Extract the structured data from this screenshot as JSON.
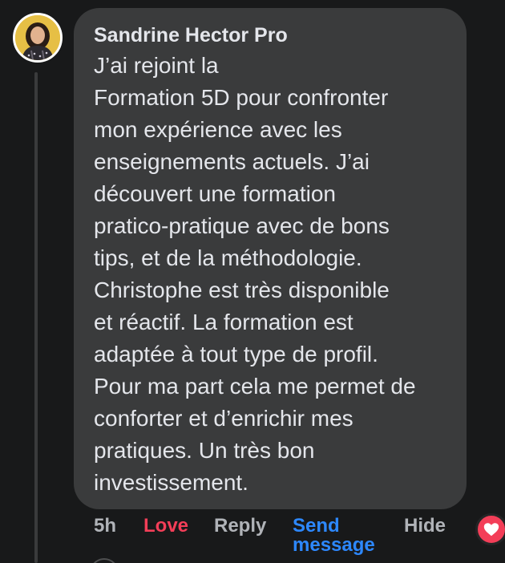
{
  "comment": {
    "author": "Sandrine Hector Pro",
    "body_lines": [
      "J’ai rejoint la",
      "Formation 5D pour confronter",
      "mon expérience avec les",
      "enseignements actuels. J’ai",
      "découvert une formation",
      "pratico-pratique avec de bons",
      "tips, et de la méthodologie.",
      "Christophe est très disponible",
      "et réactif. La formation est",
      "adaptée à tout type de profil.",
      "Pour ma part cela me permet de",
      "conforter et d’enrichir mes",
      "pratiques. Un très bon",
      "investissement."
    ],
    "reaction_icon": "heart-icon"
  },
  "actions": {
    "timestamp": "5h",
    "love": "Love",
    "reply": "Reply",
    "send_message_line1": "Send",
    "send_message_line2": "message",
    "hide": "Hide"
  },
  "colors": {
    "background": "#18191a",
    "bubble": "#3a3b3c",
    "text": "#e4e6eb",
    "muted": "#b0b3b8",
    "love": "#f33e58",
    "link": "#2d88ff"
  }
}
